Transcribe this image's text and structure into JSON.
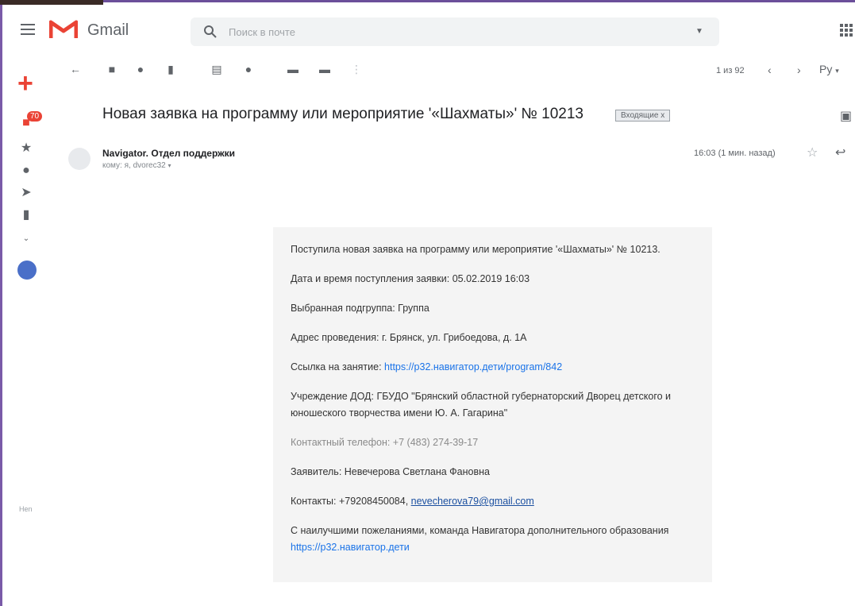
{
  "app": {
    "name": "Gmail",
    "colors": {
      "logo_red": "#ea4335",
      "link": "#1a73e8",
      "card_bg": "#f4f4f4",
      "accent": "#6b4f9a"
    }
  },
  "search": {
    "placeholder": "Поиск в почте"
  },
  "nav": {
    "inbox_badge": "70",
    "hangout_label": "Hen"
  },
  "pager": {
    "text": "1 из 92",
    "prev": "‹",
    "next": "›",
    "lang": "Ру"
  },
  "email": {
    "subject": "Новая заявка на программу или мероприятие '«Шахматы»' № 10213",
    "label": "Входящие x",
    "sender": "Navigator. Отдел поддержки",
    "recipient": "кому: я, dvorec32",
    "time": "16:03 (1 мин. назад)"
  },
  "body": {
    "p1": "Поступила новая заявка на программу или мероприятие '«Шахматы»' № 10213.",
    "p2": "Дата и время поступления заявки: 05.02.2019 16:03",
    "p3": "Выбранная подгруппа: Группа",
    "p4": "Адрес проведения: г. Брянск, ул. Грибоедова, д. 1А",
    "p5_label": "Ссылка на занятие: ",
    "p5_link": "https://p32.навигатор.дети/program/842",
    "p6": "Учреждение ДОД: ГБУДО \"Брянский областной губернаторский Дворец детского и юношеского творчества имени Ю. А. Гагарина\"",
    "p7": "Контактный телефон: +7 (483) 274-39-17",
    "p8": "Заявитель: Невечерова Светлана Фановна",
    "p9_label": "Контакты: +79208450084, ",
    "p9_email": "nevecherova79@gmail.com",
    "p10_text": "С наилучшими пожеланиями, команда Навигатора дополнительного образования ",
    "p10_link": "https://p32.навигатор.дети"
  }
}
